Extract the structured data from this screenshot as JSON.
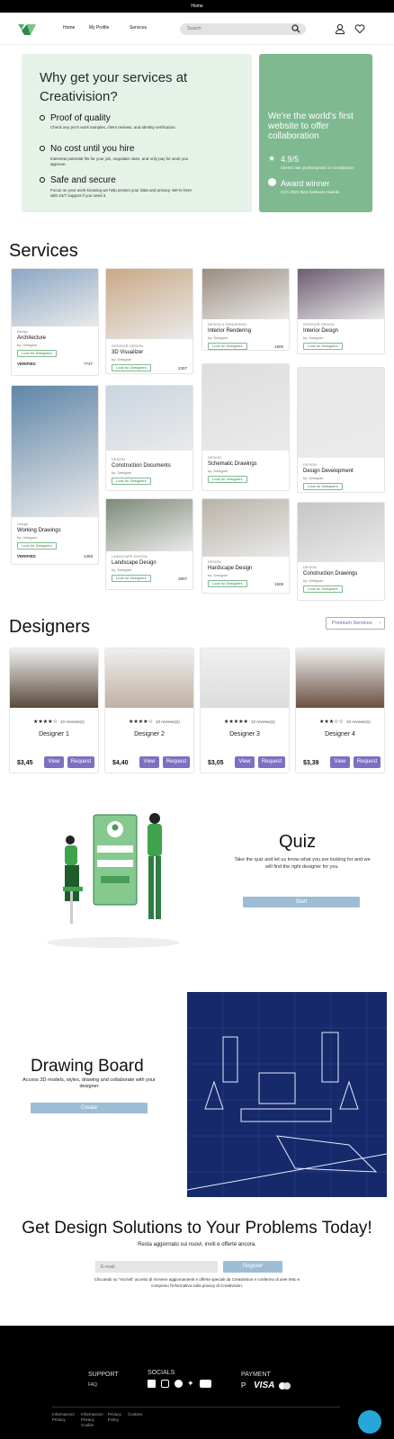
{
  "topbar": {
    "text": "Home"
  },
  "nav": {
    "links": [
      "Home",
      "My Profile",
      "Services"
    ],
    "search_placeholder": "Search"
  },
  "hero": {
    "title": "Why get your services at Creativision?",
    "benefits": [
      {
        "title": "Proof of quality",
        "text": "Check any pro's work samples, client reviews, and identity verification."
      },
      {
        "title": "No cost until you hire",
        "text": "Interview potential fits for your job, negotiate rates, and only pay for work you approve."
      },
      {
        "title": "Safe and secure",
        "text": "Focus on your work knowing we help protect your data and privacy. We're here with 24/7 support if you need it."
      }
    ],
    "highlight": {
      "title": "We're the world's first website to offer collaboration",
      "rating": "4.9/5",
      "rating_sub": "Clients rate professionals on Creativision",
      "award": "Award winner",
      "award_sub": "G2's 2023 Best Software Awards"
    }
  },
  "services": {
    "heading": "Services",
    "cards": [
      {
        "category": "Design",
        "title": "Architecture",
        "by": "by: Designer",
        "button": "Look for Designers",
        "verified": "VERIFIED",
        "price": "7737"
      },
      {
        "category": "INTERIOR DESIGN",
        "title": "3D Visualizer",
        "by": "by: Designer",
        "button": "Look for Designers",
        "verified": "",
        "price": "2307"
      },
      {
        "category": "DESIGN & RENDERING",
        "title": "Interior Rendering",
        "by": "by: Designer",
        "button": "Look for Designers",
        "verified": "",
        "price": "1905"
      },
      {
        "category": "INTERIOR DESIGN",
        "title": "Interior Design",
        "by": "by: Designer",
        "button": "Look for Designers",
        "verified": "",
        "price": ""
      },
      {
        "category": "Design",
        "title": "Working Drawings",
        "by": "by: Designer",
        "button": "Look for Designers",
        "verified": "VERIFIED",
        "price": "1458"
      },
      {
        "category": "DESIGN",
        "title": "Construction Documents",
        "by": "by: Designer",
        "button": "Look for Designers",
        "verified": "",
        "price": ""
      },
      {
        "category": "DESIGN",
        "title": "Schematic Drawings",
        "by": "by: Designer",
        "button": "Look for Designers",
        "verified": "",
        "price": ""
      },
      {
        "category": "DESIGN",
        "title": "Design Development",
        "by": "by: Designer",
        "button": "Look for Designers",
        "verified": "",
        "price": ""
      },
      {
        "category": "LANDSCAPE DESIGN",
        "title": "Landscape Design",
        "by": "by: Designer",
        "button": "Look for Designers",
        "verified": "",
        "price": "3907"
      },
      {
        "category": "DESIGN",
        "title": "Hardscape Design",
        "by": "by: Designer",
        "button": "Look for Designers",
        "verified": "",
        "price": "1509"
      },
      {
        "category": "DESIGN",
        "title": "Construction Drawings",
        "by": "by: Designer",
        "button": "Look for Designers",
        "verified": "",
        "price": ""
      }
    ]
  },
  "designers": {
    "heading": "Designers",
    "premium_button": "Premium Services",
    "cards": [
      {
        "name": "Designer 1",
        "stars": "★★★★☆",
        "reviews": "10 reviews(s)",
        "price": "$3,45",
        "view": "View",
        "request": "Request",
        "rating": 4
      },
      {
        "name": "Designer 2",
        "stars": "★★★★☆",
        "reviews": "10 reviews(s)",
        "price": "$4,40",
        "view": "View",
        "request": "Request",
        "rating": 4
      },
      {
        "name": "Designer 3",
        "stars": "★★★★★",
        "reviews": "10 reviews(s)",
        "price": "$3,05",
        "view": "View",
        "request": "Request",
        "rating": 5
      },
      {
        "name": "Designer 4",
        "stars": "★★★☆☆",
        "reviews": "10 reviews(s)",
        "price": "$3,39",
        "view": "View",
        "request": "Request",
        "rating": 3
      }
    ]
  },
  "quiz": {
    "title": "Quiz",
    "subtitle": "Take the quiz and let us know what you are looking for and we will find the right designer for you.",
    "button": "Start"
  },
  "drawing_board": {
    "title": "Drawing Board",
    "subtitle": "Access 3D models, styles, drawing and collaborate with your designer",
    "button": "Create"
  },
  "cta": {
    "title": "Get Design Solutions to Your Problems Today!",
    "subtitle": "Resta aggiornato sui nuovi, inviti e offerte ancora.",
    "email_placeholder": "E-mail",
    "register": "Register",
    "fineprint": "Cliccando su \"Iscriviti\" accetto di ricevere aggiornamenti e offerte speciali da Creativision e confermo di aver letto e compreso l'Informativa sulla privacy di Creativision."
  },
  "footer": {
    "support": {
      "heading": "SUPPORT",
      "links": [
        "FAQ"
      ]
    },
    "socials": {
      "heading": "SOCIALS"
    },
    "payment": {
      "heading": "PAYMENT",
      "visa": "VISA"
    },
    "bottom_links": [
      [
        "Informazioni",
        "Privacy"
      ],
      [
        "Informazioni",
        "Privacy",
        "Cookie"
      ],
      [
        "Privacy",
        "Policy"
      ],
      [
        "Cookies"
      ]
    ]
  }
}
